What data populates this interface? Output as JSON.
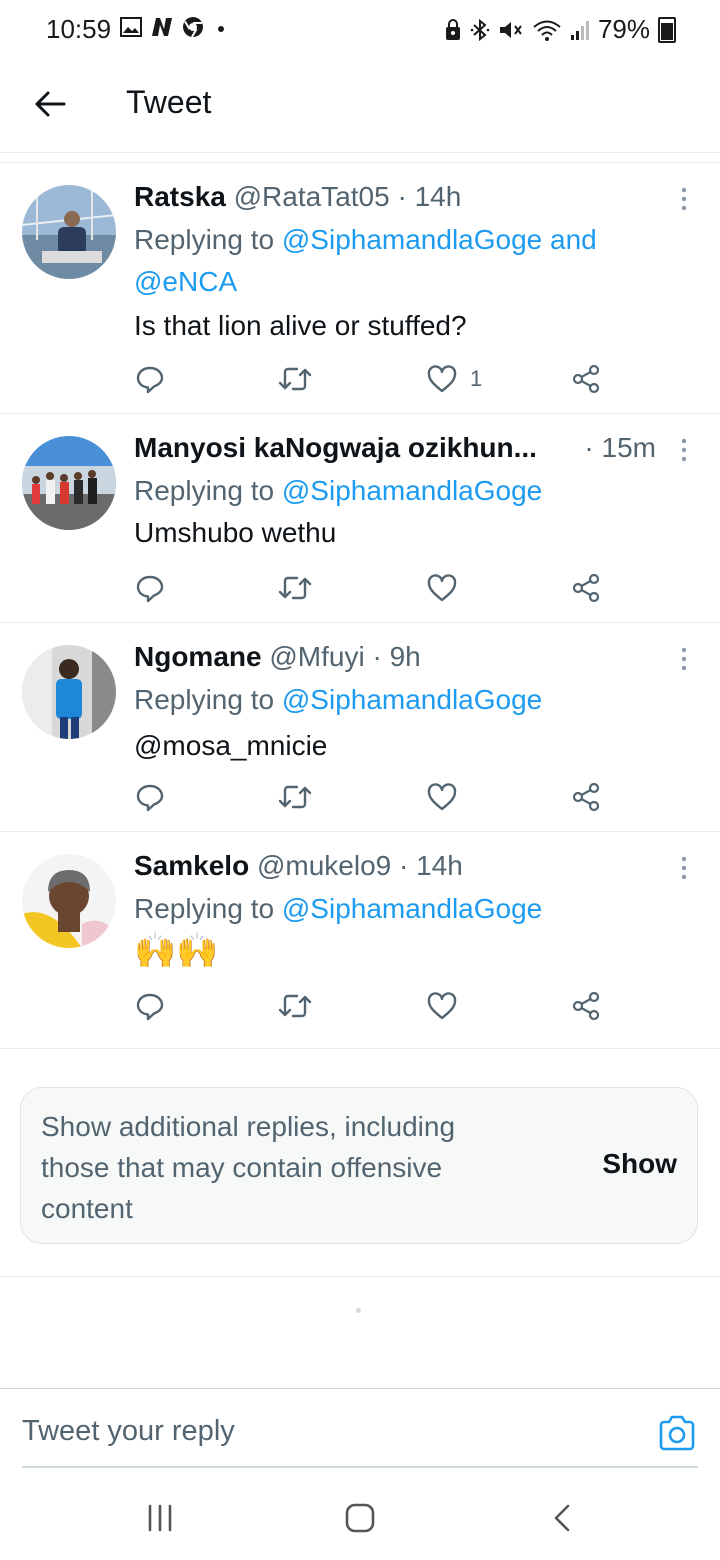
{
  "status_bar": {
    "time": "10:59",
    "battery": "79%",
    "left_icons": [
      "image-icon",
      "n-app-icon",
      "chrome-icon",
      "dot-icon"
    ],
    "right_icons": [
      "lock-icon",
      "bluetooth-icon",
      "mute-icon",
      "wifi-icon",
      "signal-icon",
      "battery-icon"
    ]
  },
  "header": {
    "title": "Tweet",
    "back_icon": "arrow-left-icon"
  },
  "tweets": [
    {
      "name": "Ratska",
      "handle": "@RataTat05",
      "time": "· 14h",
      "replying_prefix": "Replying to",
      "replying_to_1": "@SiphamandlaGoge",
      "replying_join": "and",
      "replying_to_2": "@eNCA",
      "text": "Is that lion alive or stuffed?",
      "likes": "1"
    },
    {
      "name": "Manyosi kaNogwaja ozikhun...",
      "time": "· 15m",
      "replying_prefix": "Replying to",
      "replying_to_1": "@SiphamandlaGoge",
      "text": "Umshubo wethu"
    },
    {
      "name": "Ngomane",
      "handle": "@Mfuyi",
      "time": "· 9h",
      "replying_prefix": "Replying to",
      "replying_to_1": "@SiphamandlaGoge",
      "text": "@mosa_mnicie"
    },
    {
      "name": "Samkelo",
      "handle": "@mukelo9",
      "time": "· 14h",
      "replying_prefix": "Replying to",
      "replying_to_1": "@SiphamandlaGoge",
      "text": "🙌🙌"
    }
  ],
  "more_replies": {
    "text": "Show additional replies, including those that may contain offensive content",
    "button": "Show"
  },
  "reply_bar": {
    "placeholder": "Tweet your reply",
    "camera_icon": "camera-icon"
  },
  "nav_bar": {
    "icons": [
      "recent-apps-icon",
      "home-icon",
      "back-icon"
    ]
  },
  "colors": {
    "link": "#1d9bf0",
    "text": "#0f1419",
    "muted": "#536471",
    "border": "#e6ecf0"
  }
}
